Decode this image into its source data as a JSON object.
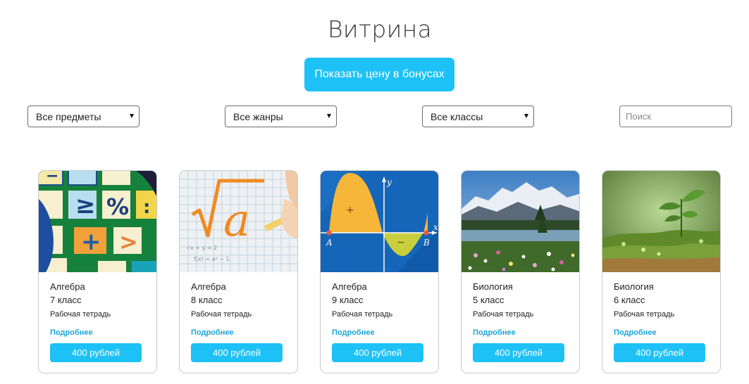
{
  "page": {
    "title": "Витрина"
  },
  "bonus_button": {
    "label": "Показать цену в бонусах"
  },
  "filters": {
    "subjects": "Все предметы",
    "genres": "Все жанры",
    "grades": "Все классы",
    "search_placeholder": "Поиск"
  },
  "colors": {
    "accent": "#1dc1f6",
    "link": "#1da6d8"
  },
  "cards": [
    {
      "subject": "Алгебра",
      "grade": "7 класс",
      "type": "Рабочая тетрадь",
      "more": "Подробнее",
      "price": "400 рублей",
      "image": "algebra-symbols-image"
    },
    {
      "subject": "Алгебра",
      "grade": "8 класс",
      "type": "Рабочая тетрадь",
      "more": "Подробнее",
      "price": "400 рублей",
      "image": "square-root-image"
    },
    {
      "subject": "Алгебра",
      "grade": "9 класс",
      "type": "Рабочая тетрадь",
      "more": "Подробнее",
      "price": "400 рублей",
      "image": "function-graph-image"
    },
    {
      "subject": "Биология",
      "grade": "5 класс",
      "type": "Рабочая тетрадь",
      "more": "Подробнее",
      "price": "400 рублей",
      "image": "mountain-lake-image"
    },
    {
      "subject": "Биология",
      "grade": "6 класс",
      "type": "Рабочая тетрадь",
      "more": "Подробнее",
      "price": "400 рублей",
      "image": "seedling-moss-image"
    }
  ]
}
